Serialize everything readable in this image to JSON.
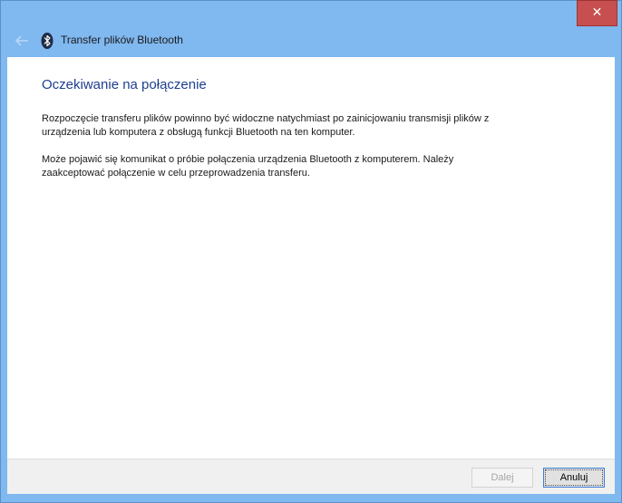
{
  "window": {
    "title": "Transfer plików Bluetooth",
    "close_glyph": "✕",
    "accent_color": "#80b8f0",
    "close_color": "#c74f4f"
  },
  "icons": {
    "back": "back-arrow-icon",
    "app": "bluetooth-icon",
    "close": "close-icon"
  },
  "content": {
    "heading": "Oczekiwanie na połączenie",
    "paragraph1": "Rozpoczęcie transferu plików powinno być widoczne natychmiast po zainicjowaniu transmisji plików z urządzenia lub komputera z obsługą funkcji Bluetooth na ten komputer.",
    "paragraph2": "Może pojawić się komunikat o próbie połączenia urządzenia Bluetooth z komputerem. Należy zaakceptować połączenie w celu przeprowadzenia transferu."
  },
  "footer": {
    "next_label": "Dalej",
    "cancel_label": "Anuluj"
  }
}
